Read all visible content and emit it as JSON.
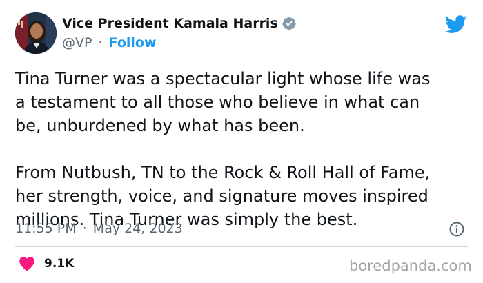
{
  "author": {
    "display_name": "Vice President Kamala Harris",
    "handle": "@VP",
    "separator": "·",
    "follow_label": "Follow",
    "verified_icon": "verified-badge-icon",
    "verified_color": "#829aab"
  },
  "brand": {
    "logo_icon": "twitter-bird-icon",
    "logo_color": "#1d9bf0"
  },
  "tweet": {
    "lines": [
      "Tina Turner was a spectacular light whose life was",
      "a testament to all those who believe in what can",
      "be, unburdened by what has been.",
      "",
      "From Nutbush, TN to the Rock & Roll Hall of Fame,",
      "her strength, voice, and signature moves inspired",
      "millions. Tina Turner was simply the best."
    ]
  },
  "meta": {
    "time": "11:55 PM",
    "separator": "·",
    "date": "May 24, 2023",
    "info_icon": "info-icon"
  },
  "engagement": {
    "like_icon": "heart-icon",
    "like_color": "#f91880",
    "like_count": "9.1K"
  },
  "watermark": "boredpanda.com"
}
